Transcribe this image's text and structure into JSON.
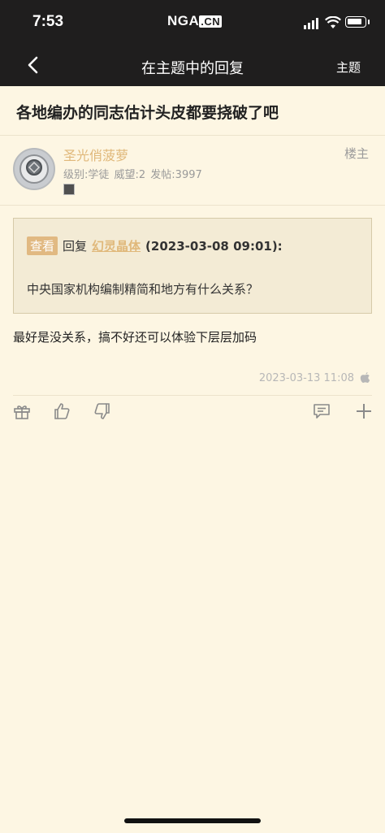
{
  "status_bar": {
    "time": "7:53",
    "carrier": "NGA",
    "carrier_suffix": ".CN"
  },
  "nav": {
    "title": "在主题中的回复",
    "right_label": "主题"
  },
  "topic": {
    "title": "各地编办的同志估计头皮都要挠破了吧"
  },
  "post": {
    "author": "圣光俏菠萝",
    "author_tag": "楼主",
    "meta": "级别:学徒   威望:2   发帖:3997",
    "quote": {
      "view_label": "查看",
      "reply_label": "回复",
      "quoted_user": "幻灵晶体",
      "quoted_datetime": "(2023-03-08 09:01):",
      "quoted_text": "中央国家机构编制精简和地方有什么关系？"
    },
    "content": "最好是没关系，搞不好还可以体验下层层加码",
    "timestamp": "2023-03-13 11:08",
    "device_icon": "apple-icon"
  },
  "actions": [
    "gift-icon",
    "thumbs-up-icon",
    "thumbs-down-icon",
    "comment-icon",
    "plus-icon"
  ],
  "colors": {
    "background": "#fdf6e3",
    "header": "#1f1e1e",
    "accent": "#e0b87a"
  }
}
